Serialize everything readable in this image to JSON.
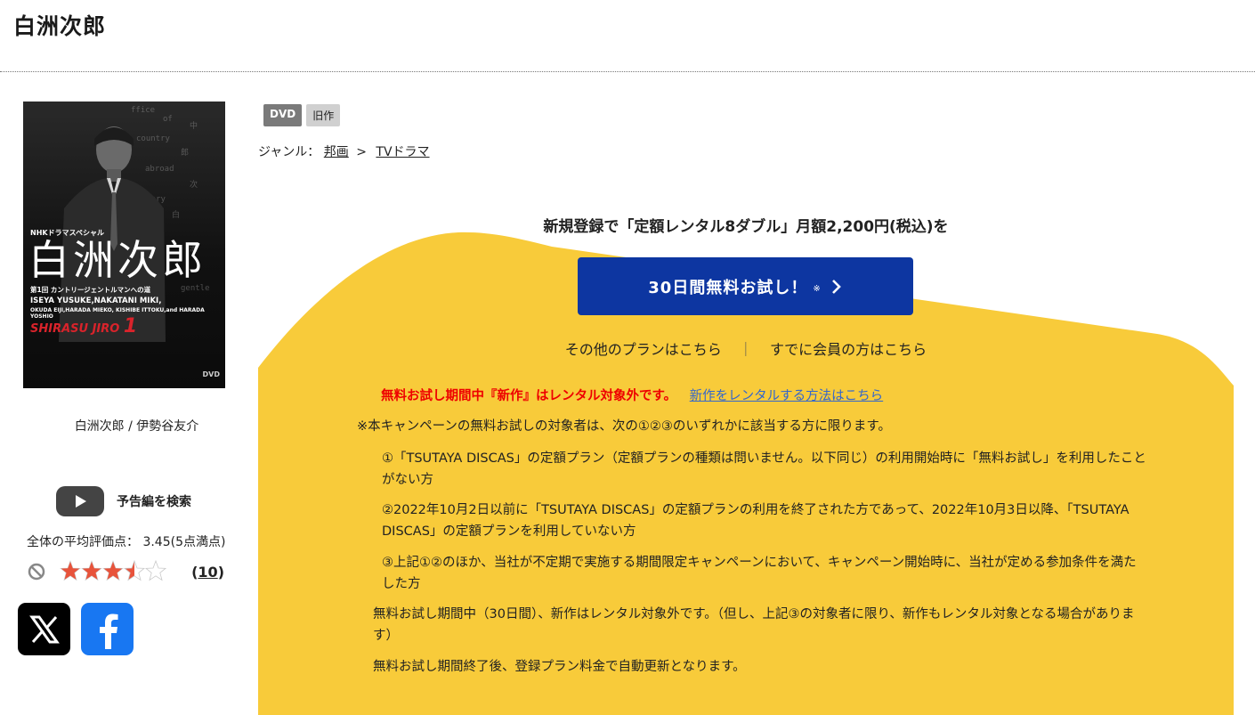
{
  "page": {
    "title": "白洲次郎"
  },
  "cover": {
    "series_label": "NHKドラマスペシャル",
    "title_kanji": "白洲次郎",
    "episode_line": "第1回 カントリージェントルマンへの道",
    "cast_line": "ISEYA YUSUKE,NAKATANI MIKI,",
    "cast_line_2": "OKUDA EIJI,HARADA MIEKO, KISHIBE ITTOKU,and HARADA YOSHIO",
    "roman_title": "SHIRASU JIRO",
    "volume": "1",
    "dvd_mark": "DVD"
  },
  "sidebar": {
    "credits": "白洲次郎 / 伊勢谷友介",
    "trailer_label": "予告編を検索",
    "average_rating": "全体の平均評価点： 3.45(5点満点)",
    "review_count": "10",
    "rating_value": 3.45,
    "rating_max": 5
  },
  "badges": {
    "format": "DVD",
    "release_type": "旧作"
  },
  "genre": {
    "label": "ジャンル：",
    "primary": "邦画",
    "separator": ">",
    "secondary": "TVドラマ"
  },
  "promo": {
    "headline": "新規登録で「定額レンタル8ダブル」月額2,200円(税込)を",
    "cta_label": "30日間無料お試し！",
    "cta_mark": "※",
    "other_plans": "その他のプランはこちら",
    "divider": "｜",
    "member_link": "すでに会員の方はこちら",
    "warning_red": "無料お試し期間中『新作』はレンタル対象外です。",
    "warning_link": "新作をレンタルする方法はこちら",
    "notes": {
      "intro": "※本キャンペーンの無料お試しの対象者は、次の①②③のいずれかに該当する方に限ります。",
      "item1": "①「TSUTAYA DISCAS」の定額プラン（定額プランの種類は問いません。以下同じ）の利用開始時に「無料お試し」を利用したことがない方",
      "item2": "②2022年10月2日以前に「TSUTAYA DISCAS」の定額プランの利用を終了された方であって、2022年10月3日以降、「TSUTAYA DISCAS」の定額プランを利用していない方",
      "item3": "③上記①②のほか、当社が不定期で実施する期間限定キャンペーンにおいて、キャンペーン開始時に、当社が定める参加条件を満たした方",
      "trial_period": "無料お試し期間中（30日間）、新作はレンタル対象外です。（但し、上記③の対象者に限り、新作もレンタル対象となる場合があります）",
      "auto_renew": "無料お試し期間終了後、登録プラン料金で自動更新となります。"
    }
  },
  "colors": {
    "promo_yellow": "#f8cb3a",
    "cta_blue": "#0d36a1",
    "warning_red": "#e00000",
    "link_blue": "#3366cc",
    "star_fill": "#e8533b"
  }
}
